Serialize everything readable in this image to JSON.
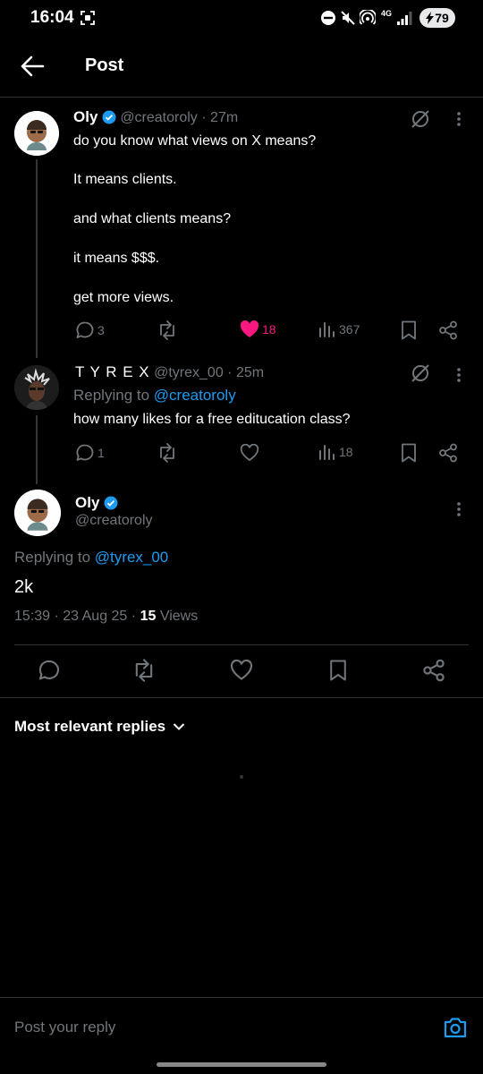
{
  "status": {
    "time": "16:04",
    "battery": "79",
    "network": "4G"
  },
  "header": {
    "title": "Post"
  },
  "post1": {
    "name": "Oly",
    "handle": "@creatoroly",
    "time": "· 27m",
    "lines": [
      "do you know what views on X means?",
      "It means clients.",
      "and what clients means?",
      "it means $$$.",
      "get more views."
    ],
    "replies": "3",
    "likes": "18",
    "views": "367"
  },
  "post2": {
    "name": "T Y R E X",
    "handle": "@tyrex_00",
    "time": "· 25m",
    "replying_prefix": "Replying to",
    "replying_to": "@creatoroly",
    "text": "how many likes for a free editucation class?",
    "replies": "1",
    "views": "18"
  },
  "main": {
    "name": "Oly",
    "handle": "@creatoroly",
    "replying_prefix": "Replying to",
    "replying_to": "@tyrex_00",
    "text": "2k",
    "timestamp": "15:39 · 23 Aug 25 ·",
    "view_count": "15",
    "views_label": "Views"
  },
  "sort": {
    "label": "Most relevant replies"
  },
  "reply_bar": {
    "placeholder": "Post your reply"
  },
  "colors": {
    "background": "#000000",
    "accent": "#1d9bf0",
    "like": "#f91880",
    "muted": "#71767b",
    "divider": "#2f3336"
  }
}
